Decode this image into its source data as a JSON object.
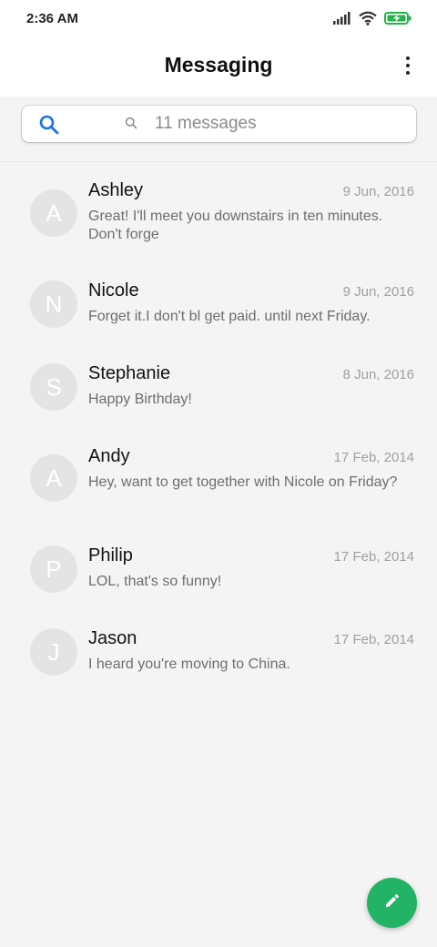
{
  "status_bar": {
    "time": "2:36 AM",
    "icons": [
      "signal-icon",
      "wifi-icon",
      "battery-charging-icon"
    ],
    "battery_color": "#23b34a"
  },
  "header": {
    "title": "Messaging",
    "menu_icon": "more-vert-icon"
  },
  "search": {
    "placeholder": "11 messages",
    "icon_color": "#1a73e8"
  },
  "conversations": [
    {
      "initial": "A",
      "name": "Ashley",
      "date": "9 Jun, 2016",
      "snippet": "Great! I'll meet you downstairs in ten minutes. Don't forge"
    },
    {
      "initial": "N",
      "name": "Nicole",
      "date": "9 Jun, 2016",
      "snippet": "Forget it.I don't bl get paid. until next Friday."
    },
    {
      "initial": "S",
      "name": "Stephanie",
      "date": "8 Jun, 2016",
      "snippet": "Happy Birthday!"
    },
    {
      "initial": "A",
      "name": "Andy",
      "date": "17 Feb, 2014",
      "snippet": "Hey, want to get together with Nicole on Friday?"
    },
    {
      "initial": "P",
      "name": "Philip",
      "date": "17 Feb, 2014",
      "snippet": "LOL, that's so funny!"
    },
    {
      "initial": "J",
      "name": "Jason",
      "date": "17 Feb, 2014",
      "snippet": "I heard you're moving to China."
    }
  ],
  "fab": {
    "icon": "pencil-icon",
    "color": "#23b366"
  }
}
